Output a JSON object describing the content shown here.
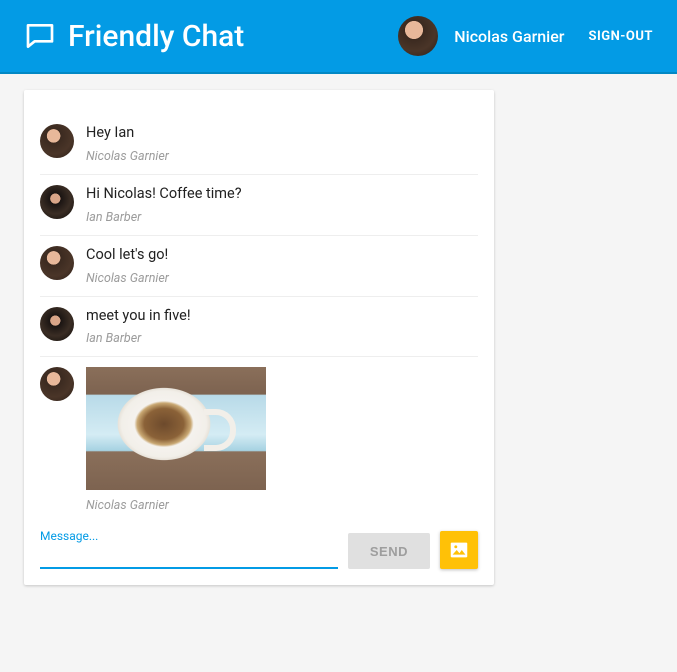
{
  "header": {
    "title": "Friendly Chat",
    "username": "Nicolas Garnier",
    "signout_label": "SIGN-OUT"
  },
  "messages": [
    {
      "text": "Hey Ian",
      "author": "Nicolas Garnier",
      "avatar": "nicolas",
      "type": "text"
    },
    {
      "text": "Hi Nicolas! Coffee time?",
      "author": "Ian Barber",
      "avatar": "ian",
      "type": "text"
    },
    {
      "text": "Cool let's go!",
      "author": "Nicolas Garnier",
      "avatar": "nicolas",
      "type": "text"
    },
    {
      "text": "meet you in five!",
      "author": "Ian Barber",
      "avatar": "ian",
      "type": "text"
    },
    {
      "image_alt": "coffee cup photo",
      "author": "Nicolas Garnier",
      "avatar": "nicolas",
      "type": "image"
    }
  ],
  "composer": {
    "placeholder": "Message...",
    "value": "",
    "send_label": "SEND"
  },
  "icons": {
    "chat": "chat-icon",
    "image": "image-icon"
  },
  "colors": {
    "primary": "#039be5",
    "accent": "#ffc107"
  }
}
